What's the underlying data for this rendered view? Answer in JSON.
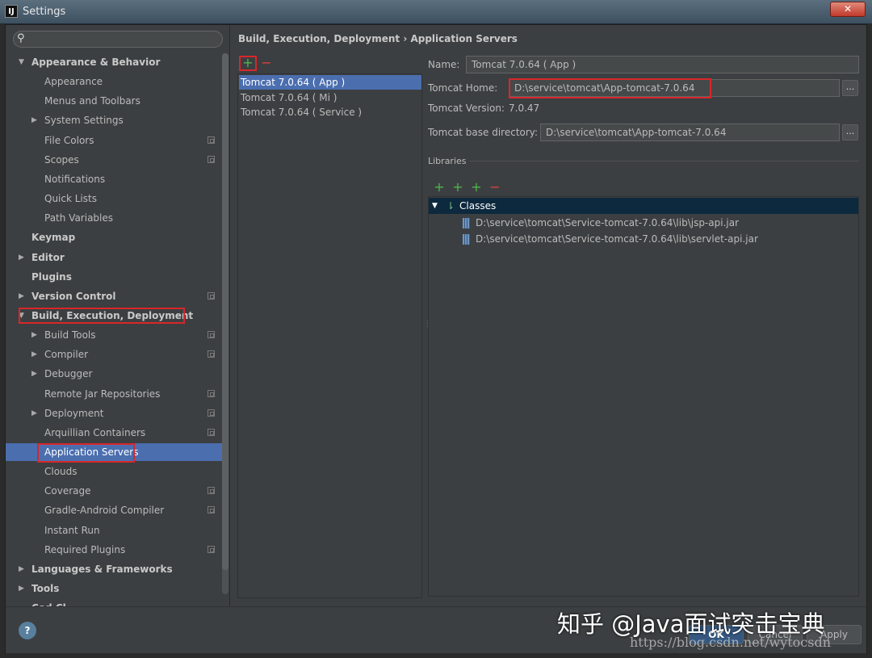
{
  "window": {
    "title": "Settings",
    "app_icon": "IJ",
    "close_label": "✕"
  },
  "search": {
    "placeholder": "",
    "icon": "search-icon"
  },
  "tree": [
    {
      "label": "Appearance & Behavior",
      "level": 0,
      "expanded": true,
      "bold": true
    },
    {
      "label": "Appearance",
      "level": 1
    },
    {
      "label": "Menus and Toolbars",
      "level": 1
    },
    {
      "label": "System Settings",
      "level": 1,
      "collapsible": true
    },
    {
      "label": "File Colors",
      "level": 1,
      "project": true
    },
    {
      "label": "Scopes",
      "level": 1,
      "project": true
    },
    {
      "label": "Notifications",
      "level": 1
    },
    {
      "label": "Quick Lists",
      "level": 1
    },
    {
      "label": "Path Variables",
      "level": 1
    },
    {
      "label": "Keymap",
      "level": 0,
      "bold": true
    },
    {
      "label": "Editor",
      "level": 0,
      "bold": true,
      "collapsible": true
    },
    {
      "label": "Plugins",
      "level": 0,
      "bold": true
    },
    {
      "label": "Version Control",
      "level": 0,
      "bold": true,
      "collapsible": true,
      "project": true
    },
    {
      "label": "Build, Execution, Deployment",
      "level": 0,
      "bold": true,
      "expanded": true
    },
    {
      "label": "Build Tools",
      "level": 1,
      "collapsible": true,
      "project": true
    },
    {
      "label": "Compiler",
      "level": 1,
      "collapsible": true,
      "project": true
    },
    {
      "label": "Debugger",
      "level": 1,
      "collapsible": true
    },
    {
      "label": "Remote Jar Repositories",
      "level": 1,
      "project": true
    },
    {
      "label": "Deployment",
      "level": 1,
      "collapsible": true,
      "project": true
    },
    {
      "label": "Arquillian Containers",
      "level": 1,
      "project": true
    },
    {
      "label": "Application Servers",
      "level": 1,
      "selected": true
    },
    {
      "label": "Clouds",
      "level": 1
    },
    {
      "label": "Coverage",
      "level": 1,
      "project": true
    },
    {
      "label": "Gradle-Android Compiler",
      "level": 1,
      "project": true
    },
    {
      "label": "Instant Run",
      "level": 1
    },
    {
      "label": "Required Plugins",
      "level": 1,
      "project": true
    },
    {
      "label": "Languages & Frameworks",
      "level": 0,
      "bold": true,
      "collapsible": true
    },
    {
      "label": "Tools",
      "level": 0,
      "bold": true,
      "collapsible": true
    },
    {
      "label": "Cod  Cl",
      "level": 0,
      "bold": true
    }
  ],
  "breadcrumb": {
    "parent": "Build, Execution, Deployment",
    "separator": "›",
    "current": "Application Servers"
  },
  "toolbar": {
    "add": "+",
    "remove": "−"
  },
  "servers": [
    {
      "label": "Tomcat 7.0.64 ( App )",
      "selected": true
    },
    {
      "label": "Tomcat 7.0.64 ( Mi )"
    },
    {
      "label": "Tomcat 7.0.64 ( Service )"
    }
  ],
  "form": {
    "name_label": "Name:",
    "name_value": "Tomcat 7.0.64 ( App )",
    "home_label": "Tomcat Home:",
    "home_value": "D:\\service\\tomcat\\App-tomcat-7.0.64",
    "version_label": "Tomcat Version:",
    "version_value": "7.0.47",
    "base_label": "Tomcat base directory:",
    "base_value": "D:\\service\\tomcat\\App-tomcat-7.0.64",
    "browse_label": "..."
  },
  "libraries": {
    "title": "Libraries",
    "tools": [
      "+",
      "+",
      "+",
      "−"
    ],
    "classes_label": "Classes",
    "jars": [
      "D:\\service\\tomcat\\Service-tomcat-7.0.64\\lib\\jsp-api.jar",
      "D:\\service\\tomcat\\Service-tomcat-7.0.64\\lib\\servlet-api.jar"
    ]
  },
  "footer": {
    "help": "?",
    "ok": "OK",
    "cancel": "Cancel",
    "apply": "Apply"
  },
  "watermark": {
    "zhihu": "知乎 @Java面试突击宝典",
    "url": "https://blog.csdn.net/wytocsdn"
  },
  "colors": {
    "accent": "#4b6eaf",
    "highlight": "#d9262a",
    "add": "#4fb34f",
    "remove": "#e0413e"
  }
}
